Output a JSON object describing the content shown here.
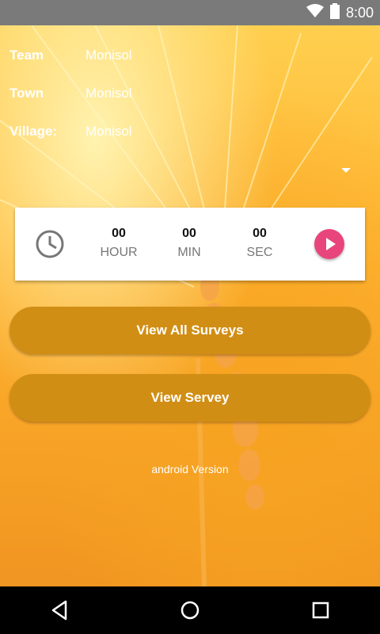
{
  "status_bar": {
    "time": "8:00"
  },
  "info": [
    {
      "label": "Team",
      "value": "Monisol"
    },
    {
      "label": "Town",
      "value": "Monisol"
    },
    {
      "label": "Village:",
      "value": "Monisol"
    }
  ],
  "timer": {
    "hour_value": "00",
    "hour_label": "HOUR",
    "min_value": "00",
    "min_label": "MIN",
    "sec_value": "00",
    "sec_label": "SEC"
  },
  "buttons": {
    "view_all_surveys": "View All Surveys",
    "view_servey": "View Servey"
  },
  "footer": {
    "version_text": "android Version"
  },
  "colors": {
    "button_bg": "#d18e14",
    "play_button": "#e8457d",
    "status_bar": "#7a7a7a"
  },
  "icons": [
    "wifi-icon",
    "battery-icon",
    "clock-icon",
    "play-icon",
    "back-icon",
    "home-icon",
    "recents-icon",
    "dropdown-arrow-icon"
  ]
}
